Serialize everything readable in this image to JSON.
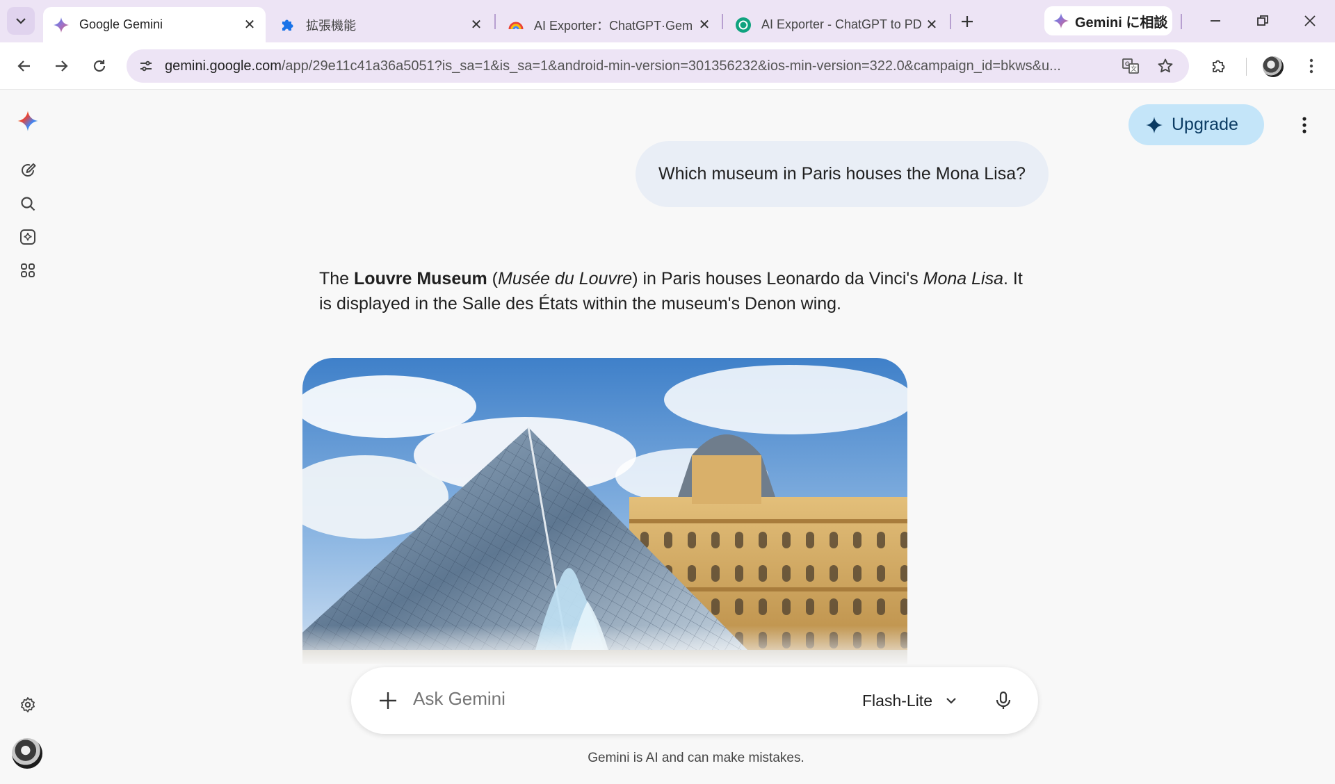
{
  "browser": {
    "tabs": [
      {
        "title": "Google Gemini",
        "icon": "gemini-spark-icon",
        "active": true
      },
      {
        "title": "拡張機能",
        "icon": "puzzle-piece-icon",
        "active": false
      },
      {
        "title": "AI Exporter：ChatGPT·Gem",
        "icon": "rainbow-icon",
        "active": false
      },
      {
        "title": "AI Exporter - ChatGPT to PD",
        "icon": "chatgpt-green-icon",
        "active": false
      }
    ],
    "gemini_chip_label": "Gemini に相談",
    "url_host": "gemini.google.com",
    "url_path": "/app/29e11c41a36a5051?is_sa=1&is_sa=1&android-min-version=301356232&ios-min-version=322.0&campaign_id=bkws&u..."
  },
  "header": {
    "upgrade_label": "Upgrade"
  },
  "conversation": {
    "user_prompt": "Which museum in Paris houses the Mona Lisa?",
    "answer": {
      "p1": "The ",
      "bold1": "Louvre Museum",
      "p2": " (",
      "italic1": "Musée du Louvre",
      "p3": ") in Paris houses Leonardo da Vinci's ",
      "italic2": "Mona Lisa",
      "p4": ". It is displayed in the Salle des États within the museum's Denon wing."
    }
  },
  "input": {
    "placeholder": "Ask Gemini",
    "model_label": "Flash-Lite"
  },
  "footer": {
    "disclaimer": "Gemini is AI and can make mistakes."
  },
  "colors": {
    "tabstrip_bg": "#ede4f5",
    "upgrade_bg": "#c4e5f9",
    "user_bubble_bg": "#e9eef6"
  }
}
